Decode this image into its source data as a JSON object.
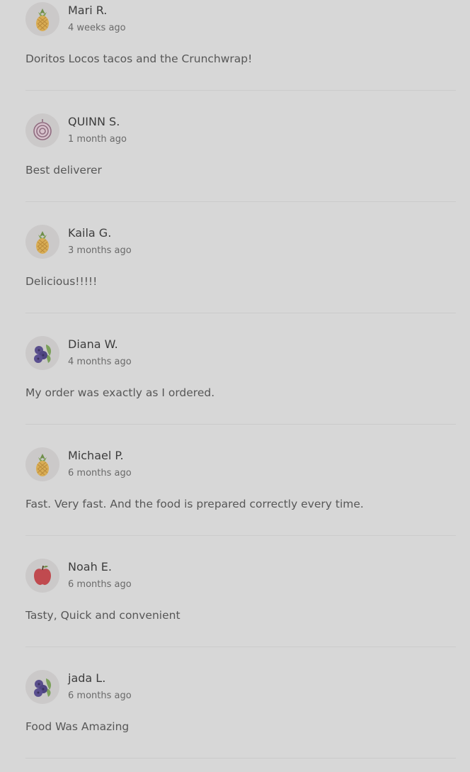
{
  "reviews": [
    {
      "name": "Mari R.",
      "time": "4 weeks ago",
      "text": "Doritos Locos tacos and the Crunchwrap!",
      "avatar_icon": "pineapple-icon"
    },
    {
      "name": "QUINN S.",
      "time": "1 month ago",
      "text": "Best deliverer",
      "avatar_icon": "onion-icon"
    },
    {
      "name": "Kaila G.",
      "time": "3 months ago",
      "text": "Delicious!!!!!",
      "avatar_icon": "pineapple-icon"
    },
    {
      "name": "Diana W.",
      "time": "4 months ago",
      "text": "My order was exactly as I ordered.",
      "avatar_icon": "blueberries-icon"
    },
    {
      "name": "Michael P.",
      "time": "6 months ago",
      "text": "Fast. Very fast. And the food is prepared correctly every time.",
      "avatar_icon": "pineapple-icon"
    },
    {
      "name": "Noah E.",
      "time": "6 months ago",
      "text": "Tasty, Quick and convenient",
      "avatar_icon": "apple-icon"
    },
    {
      "name": "jada L.",
      "time": "6 months ago",
      "text": "Food Was Amazing",
      "avatar_icon": "blueberries-icon"
    }
  ],
  "colors": {
    "background": "#d7d7d7",
    "name": "#3d3d3d",
    "time": "#6a6a6a",
    "text": "#575757",
    "divider": "#cbcbcb"
  }
}
